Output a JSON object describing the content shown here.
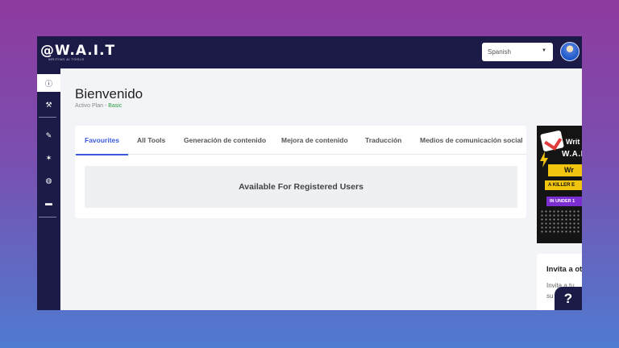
{
  "brand": {
    "logo_text": "W.A.I.T",
    "tagline": "WRITING AI TOOLS"
  },
  "header": {
    "language": "Spanish"
  },
  "sidebar": {
    "items": [
      {
        "icon": "info-icon",
        "glyph": "ⓘ"
      },
      {
        "icon": "wrench-icon",
        "glyph": "⚒"
      },
      {
        "icon": "pen-icon",
        "glyph": "✎"
      },
      {
        "icon": "magic-wand-icon",
        "glyph": "✶"
      },
      {
        "icon": "globe-icon",
        "glyph": "◍"
      },
      {
        "icon": "chat-icon",
        "glyph": "▬"
      }
    ]
  },
  "main": {
    "title": "Bienvenido",
    "plan_prefix": "Activo Plan - ",
    "plan_name": "Basic",
    "tabs": [
      {
        "label": "Favourites"
      },
      {
        "label": "All Tools"
      },
      {
        "label": "Generación de contenido"
      },
      {
        "label": "Mejora de contenido"
      },
      {
        "label": "Traducción"
      },
      {
        "label": "Medios de comunicación social"
      }
    ],
    "notice": "Available For Registered Users"
  },
  "ad": {
    "line1": "Writ",
    "logo": "W.A.I",
    "line2": "Wr",
    "line3": "A KILLER E",
    "line4": "IN UNDER 1"
  },
  "invite": {
    "title": "Invita a ot",
    "line1": "Invita a tu",
    "line2": "su"
  },
  "help": {
    "label": "?"
  },
  "colors": {
    "accent": "#3b5bdb",
    "navy": "#1c1b48",
    "plan_green": "#2e9e44"
  }
}
